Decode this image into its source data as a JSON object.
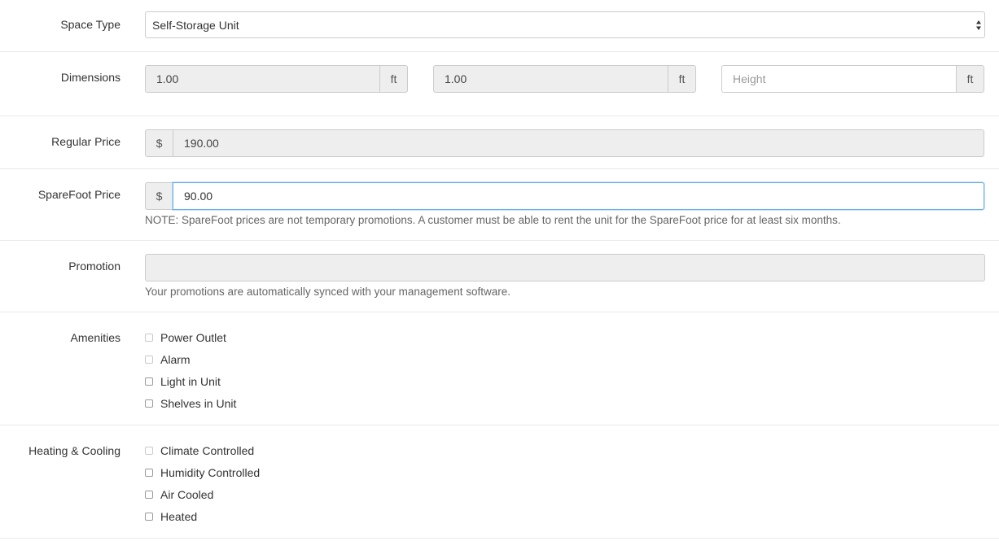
{
  "space_type": {
    "label": "Space Type",
    "value": "Self-Storage Unit"
  },
  "dimensions": {
    "label": "Dimensions",
    "width_value": "1.00",
    "length_value": "1.00",
    "height_placeholder": "Height",
    "unit": "ft"
  },
  "regular_price": {
    "label": "Regular Price",
    "currency": "$",
    "value": "190.00"
  },
  "sparefoot_price": {
    "label": "SpareFoot Price",
    "currency": "$",
    "value": "90.00",
    "note": "NOTE: SpareFoot prices are not temporary promotions. A customer must be able to rent the unit for the SpareFoot price for at least six months."
  },
  "promotion": {
    "label": "Promotion",
    "value": "",
    "help": "Your promotions are automatically synced with your management software."
  },
  "amenities": {
    "label": "Amenities",
    "items": [
      {
        "label": "Power Outlet",
        "checked": false
      },
      {
        "label": "Alarm",
        "checked": false
      },
      {
        "label": "Light in Unit",
        "checked": false
      },
      {
        "label": "Shelves in Unit",
        "checked": false
      }
    ]
  },
  "heating_cooling": {
    "label": "Heating & Cooling",
    "items": [
      {
        "label": "Climate Controlled",
        "checked": false
      },
      {
        "label": "Humidity Controlled",
        "checked": false
      },
      {
        "label": "Air Cooled",
        "checked": false
      },
      {
        "label": "Heated",
        "checked": false
      }
    ]
  }
}
